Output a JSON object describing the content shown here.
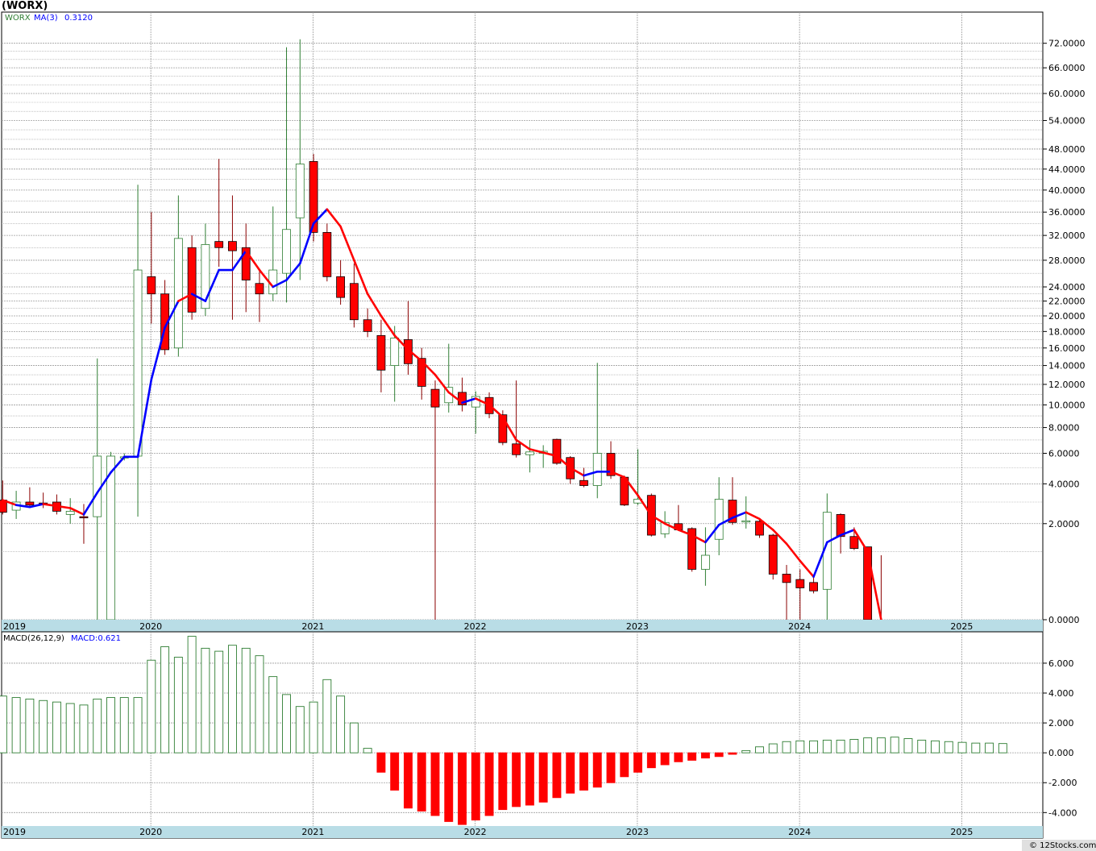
{
  "window": {
    "title": "(WORX)",
    "credit": "© 12Stocks.com"
  },
  "colors": {
    "up": "#2e7d32",
    "down": "#ff0000",
    "wick_down": "#8b0000",
    "ma_up": "#0000ff",
    "ma_down": "#ff0000",
    "grid": "#9e9e9e",
    "year_band": "#b9dde6"
  },
  "chart_data": [
    {
      "type": "candlestick",
      "title": "(WORX)",
      "legend": {
        "ticker": "WORX",
        "ma_label": "MA(3)",
        "ma_value": "0.3120"
      },
      "y_tick_labels": [
        "72.0000",
        "66.0000",
        "60.0000",
        "54.0000",
        "48.0000",
        "44.0000",
        "40.0000",
        "36.0000",
        "32.0000",
        "28.0000",
        "24.0000",
        "22.0000",
        "20.0000",
        "18.0000",
        "16.0000",
        "14.0000",
        "12.0000",
        "10.0000",
        "8.0000",
        "6.0000",
        "4.0000",
        "2.0000",
        "0.0000"
      ],
      "y_tick_values": [
        72,
        66,
        60,
        54,
        48,
        44,
        40,
        36,
        32,
        28,
        24,
        22,
        20,
        18,
        16,
        14,
        12,
        10,
        8,
        6,
        4,
        2,
        0
      ],
      "minor_grid_values": [
        70,
        68,
        64,
        62,
        58,
        56,
        52,
        50,
        46,
        42,
        38,
        34,
        30,
        26,
        23,
        21,
        19,
        17,
        15,
        13,
        11,
        9,
        7,
        5,
        3,
        1
      ],
      "ylim": [
        0,
        80
      ],
      "x_year_labels": [
        "2019",
        "2020",
        "2021",
        "2022",
        "2023",
        "2024",
        "2025"
      ],
      "x_year_positions": [
        2019.0,
        2019.92,
        2020.92,
        2021.92,
        2022.92,
        2023.92,
        2024.92
      ],
      "candles": [
        {
          "o": 3.1,
          "h": 4.2,
          "l": 2.4,
          "c": 2.5
        },
        {
          "o": 2.6,
          "h": 3.6,
          "l": 2.2,
          "c": 3.0
        },
        {
          "o": 3.0,
          "h": 3.8,
          "l": 2.7,
          "c": 2.85
        },
        {
          "o": 2.95,
          "h": 3.5,
          "l": 2.7,
          "c": 2.9
        },
        {
          "o": 3.0,
          "h": 3.4,
          "l": 2.4,
          "c": 2.55
        },
        {
          "o": 2.4,
          "h": 3.2,
          "l": 2.0,
          "c": 2.55
        },
        {
          "o": 2.3,
          "h": 2.9,
          "l": 1.25,
          "c": 2.25
        },
        {
          "o": 2.3,
          "h": 14.8,
          "l": -0.1,
          "c": 5.8
        },
        {
          "o": 0.0,
          "h": 6.1,
          "l": -0.1,
          "c": 5.8
        },
        {
          "o": 5.75,
          "h": 6.0,
          "l": 5.5,
          "c": 5.75
        },
        {
          "o": 5.8,
          "h": 41,
          "l": 2.3,
          "c": 26.5
        },
        {
          "o": 25.5,
          "h": 36,
          "l": 19,
          "c": 23.0
        },
        {
          "o": 23,
          "h": 25,
          "l": 15.2,
          "c": 15.8
        },
        {
          "o": 16,
          "h": 39,
          "l": 15,
          "c": 31.5
        },
        {
          "o": 30,
          "h": 32,
          "l": 19.5,
          "c": 20.5
        },
        {
          "o": 21,
          "h": 34,
          "l": 20,
          "c": 30.5
        },
        {
          "o": 31,
          "h": 46,
          "l": 27,
          "c": 30.0
        },
        {
          "o": 31,
          "h": 39,
          "l": 19.5,
          "c": 29.5
        },
        {
          "o": 30,
          "h": 34,
          "l": 20.5,
          "c": 25.0
        },
        {
          "o": 24.5,
          "h": 26.5,
          "l": 19.2,
          "c": 23.0
        },
        {
          "o": 23,
          "h": 37,
          "l": 22,
          "c": 26.5
        },
        {
          "o": 26,
          "h": 71,
          "l": 21.8,
          "c": 33.0
        },
        {
          "o": 35,
          "h": 73,
          "l": 25,
          "c": 45.0
        },
        {
          "o": 45.5,
          "h": 47,
          "l": 31,
          "c": 32.5
        },
        {
          "o": 32.5,
          "h": 34,
          "l": 24.8,
          "c": 25.5
        },
        {
          "o": 25.5,
          "h": 28,
          "l": 21.5,
          "c": 22.5
        },
        {
          "o": 24.5,
          "h": 27.5,
          "l": 18.5,
          "c": 19.5
        },
        {
          "o": 19.5,
          "h": 21,
          "l": 17.3,
          "c": 18
        },
        {
          "o": 17.5,
          "h": 19.5,
          "l": 11.2,
          "c": 13.5
        },
        {
          "o": 14,
          "h": 18.7,
          "l": 10.3,
          "c": 17.2
        },
        {
          "o": 17.0,
          "h": 22,
          "l": 13,
          "c": 14.2
        },
        {
          "o": 14.8,
          "h": 16,
          "l": 10.5,
          "c": 11.8
        },
        {
          "o": 11.5,
          "h": 12.4,
          "l": -0.1,
          "c": 9.8
        },
        {
          "o": 10.2,
          "h": 16.5,
          "l": 9.3,
          "c": 11.7
        },
        {
          "o": 11.2,
          "h": 12.7,
          "l": 9.4,
          "c": 10.0
        },
        {
          "o": 9.8,
          "h": 11.3,
          "l": 7.5,
          "c": 10.8
        },
        {
          "o": 10.7,
          "h": 11.2,
          "l": 8.8,
          "c": 9.2
        },
        {
          "o": 9.1,
          "h": 9.5,
          "l": 6.6,
          "c": 6.8
        },
        {
          "o": 6.7,
          "h": 12.4,
          "l": 5.7,
          "c": 5.9
        },
        {
          "o": 5.9,
          "h": 7.0,
          "l": 4.7,
          "c": 6.1
        },
        {
          "o": 6.0,
          "h": 6.6,
          "l": 5.0,
          "c": 6.15
        },
        {
          "o": 7.05,
          "h": 7.1,
          "l": 5.2,
          "c": 5.3
        },
        {
          "o": 5.7,
          "h": 5.8,
          "l": 4.0,
          "c": 4.3
        },
        {
          "o": 4.2,
          "h": 5.0,
          "l": 3.8,
          "c": 3.9
        },
        {
          "o": 3.9,
          "h": 14.3,
          "l": 3.2,
          "c": 6.0
        },
        {
          "o": 6.0,
          "h": 6.9,
          "l": 4.3,
          "c": 4.5
        },
        {
          "o": 4.4,
          "h": 4.5,
          "l": 2.8,
          "c": 2.85
        },
        {
          "o": 2.95,
          "h": 6.3,
          "l": 2.85,
          "c": 3.15
        },
        {
          "o": 3.35,
          "h": 3.45,
          "l": 1.5,
          "c": 1.55
        },
        {
          "o": 1.6,
          "h": 2.55,
          "l": 1.45,
          "c": 2.05
        },
        {
          "o": 2.0,
          "h": 2.85,
          "l": 1.75,
          "c": 1.75
        },
        {
          "o": 1.8,
          "h": 1.85,
          "l": 0.5,
          "c": 0.55
        },
        {
          "o": 0.55,
          "h": 1.85,
          "l": 0.25,
          "c": 0.9
        },
        {
          "o": 1.4,
          "h": 4.4,
          "l": 0.9,
          "c": 3.15
        },
        {
          "o": 3.1,
          "h": 4.4,
          "l": 1.95,
          "c": 2.05
        },
        {
          "o": 2.1,
          "h": 3.3,
          "l": 1.8,
          "c": 2.12
        },
        {
          "o": 2.1,
          "h": 2.2,
          "l": 1.45,
          "c": 1.55
        },
        {
          "o": 1.55,
          "h": 1.6,
          "l": 0.35,
          "c": 0.45
        },
        {
          "o": 0.45,
          "h": 0.65,
          "l": -0.05,
          "c": 0.3
        },
        {
          "o": 0.35,
          "h": 0.55,
          "l": 0.0,
          "c": 0.22
        },
        {
          "o": 0.3,
          "h": 0.4,
          "l": 0.15,
          "c": 0.18
        },
        {
          "o": 0.2,
          "h": 3.45,
          "l": 0.0,
          "c": 2.5
        },
        {
          "o": 2.4,
          "h": 2.45,
          "l": 0.95,
          "c": 1.5
        },
        {
          "o": 1.5,
          "h": 1.85,
          "l": 1.05,
          "c": 1.1
        },
        {
          "o": 1.15,
          "h": 1.15,
          "l": -0.05,
          "c": 0.0
        },
        {
          "o": null,
          "h": 0.9,
          "l": -0.05,
          "c": null
        }
      ],
      "ma3": [
        3.1,
        2.85,
        2.75,
        2.9,
        2.8,
        2.7,
        2.4,
        3.5,
        4.7,
        5.75,
        5.75,
        12.5,
        18.5,
        22.0,
        23.0,
        22.0,
        26.5,
        26.5,
        29.5,
        26.5,
        24.0,
        25.0,
        27.5,
        34.0,
        36.5,
        33.5,
        28.0,
        23.0,
        20.0,
        17.5,
        15.8,
        14.5,
        13.0,
        11.2,
        10.2,
        10.6,
        10.0,
        8.9,
        7.0,
        6.3,
        6.05,
        5.8,
        5.0,
        4.5,
        4.75,
        4.75,
        4.4,
        3.35,
        2.35,
        2.0,
        1.75,
        1.55,
        1.3,
        1.95,
        2.25,
        2.5,
        2.2,
        1.75,
        1.25,
        0.75,
        0.4,
        1.3,
        1.55,
        1.75,
        1.0,
        0.0
      ],
      "ma3_colors": [
        "down",
        "down",
        "up",
        "up",
        "down",
        "down",
        "down",
        "up",
        "up",
        "up",
        "up",
        "up",
        "up",
        "up",
        "down",
        "up",
        "up",
        "up",
        "up",
        "down",
        "down",
        "up",
        "up",
        "up",
        "up",
        "down",
        "down",
        "down",
        "down",
        "down",
        "down",
        "down",
        "down",
        "down",
        "down",
        "up",
        "down",
        "down",
        "down",
        "down",
        "down",
        "down",
        "down",
        "down",
        "up",
        "up",
        "down",
        "down",
        "down",
        "down",
        "down",
        "down",
        "down",
        "up",
        "up",
        "up",
        "down",
        "down",
        "down",
        "down",
        "down",
        "up",
        "up",
        "up",
        "down",
        "down"
      ]
    },
    {
      "type": "bar",
      "title": "MACD(26,12,9)",
      "legend": {
        "ma_label": "MACD(26,12,9)",
        "ma_value": "MACD:0.621"
      },
      "y_tick_labels": [
        "6.000",
        "4.000",
        "2.000",
        "0.000",
        "-2.000",
        "-4.000"
      ],
      "y_tick_values": [
        6,
        4,
        2,
        0,
        -2,
        -4
      ],
      "ylim": [
        -4.9,
        8.1
      ],
      "values": [
        3.8,
        3.7,
        3.6,
        3.5,
        3.4,
        3.3,
        3.2,
        3.6,
        3.7,
        3.7,
        3.7,
        6.2,
        7.1,
        6.4,
        7.8,
        7.0,
        6.8,
        7.2,
        7.0,
        6.5,
        5.1,
        3.9,
        3.1,
        3.4,
        4.9,
        3.8,
        2.0,
        0.3,
        -1.3,
        -2.5,
        -3.7,
        -3.9,
        -4.2,
        -4.6,
        -4.8,
        -4.5,
        -4.2,
        -3.8,
        -3.6,
        -3.5,
        -3.3,
        -3.0,
        -2.7,
        -2.5,
        -2.3,
        -2.0,
        -1.6,
        -1.3,
        -1.0,
        -0.8,
        -0.6,
        -0.5,
        -0.35,
        -0.25,
        -0.1,
        0.15,
        0.4,
        0.6,
        0.75,
        0.8,
        0.8,
        0.85,
        0.85,
        0.9,
        1.0,
        1.0,
        1.05,
        0.95,
        0.85,
        0.8,
        0.75,
        0.7,
        0.65,
        0.65,
        0.62
      ],
      "x_year_labels": [
        "2019",
        "2020",
        "2021",
        "2022",
        "2023",
        "2024",
        "2025"
      ]
    }
  ]
}
